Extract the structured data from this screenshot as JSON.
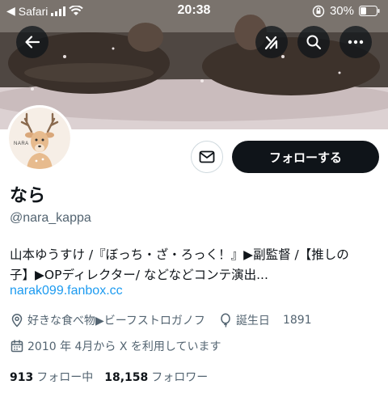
{
  "status_bar": {
    "carrier": "Safari",
    "time": "20:38",
    "battery": "30%"
  },
  "header": {
    "back_icon": "arrow-left-icon",
    "grok_icon": "grok-icon",
    "search_icon": "search-icon",
    "more_icon": "more-icon"
  },
  "avatar": {
    "brand_text": "NARA"
  },
  "actions": {
    "message_icon": "envelope-icon",
    "follow_label": "フォローする"
  },
  "profile": {
    "display_name": "なら",
    "handle": "@nara_kappa",
    "bio_line1": "山本ゆうすけ /『ぼっち・ざ・ろっく！』▶副監督 /【推しの",
    "bio_line2": "子】▶OPディレクター/ などなどコンテ演出...",
    "link": "narak099.fanbox.cc",
    "location": "好きな食べ物▶ビーフストロガノフ",
    "birthday_label": "誕生日",
    "birthday_value": "1891",
    "joined": "2010 年 4月から X を利用しています"
  },
  "stats": {
    "following_count": "913",
    "following_label": "フォロー中",
    "followers_count": "18,158",
    "followers_label": "フォロワー"
  },
  "colors": {
    "link": "#1d9bf0",
    "secondary": "#536471",
    "primary": "#0f1419"
  }
}
